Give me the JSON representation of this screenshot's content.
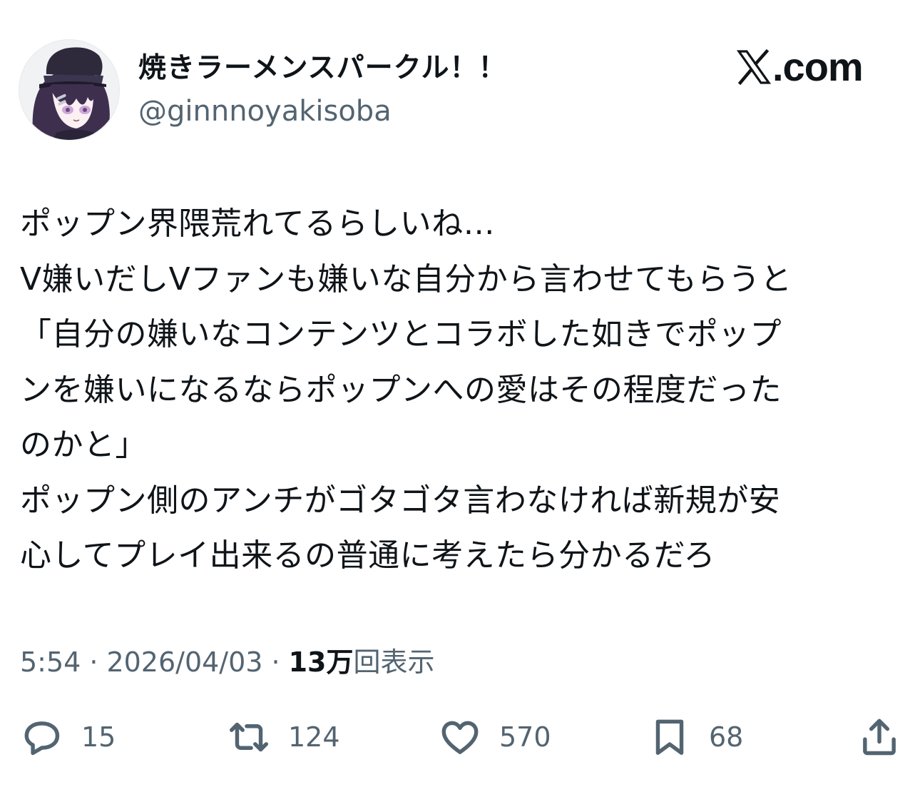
{
  "author": {
    "display_name": "焼きラーメンスパークル！！",
    "handle": "@ginnnoyakisoba"
  },
  "brand": {
    "icon": "x-logo-icon",
    "domain": ".com"
  },
  "tweet": {
    "lines": [
      "ポップン界隈荒れてるらしいね…",
      "V嫌いだしVファンも嫌いな自分から言わせてもらうと",
      "「自分の嫌いなコンテンツとコラボした如きでポップ",
      "ンを嫌いになるならポップンへの愛はその程度だった",
      "のかと」",
      "ポップン側のアンチがゴタゴタ言わなければ新規が安",
      "心してプレイ出来るの普通に考えたら分かるだろ"
    ]
  },
  "meta": {
    "time": "5:54",
    "separator": "·",
    "date": "2026/04/03",
    "views_count": "13万",
    "views_label": "回表示"
  },
  "actions": {
    "reply": {
      "icon": "reply-icon",
      "count": "15"
    },
    "repost": {
      "icon": "repost-icon",
      "count": "124"
    },
    "like": {
      "icon": "heart-icon",
      "count": "570"
    },
    "bookmark": {
      "icon": "bookmark-icon",
      "count": "68"
    },
    "share": {
      "icon": "share-icon"
    }
  },
  "colors": {
    "text_primary": "#0f1419",
    "text_secondary": "#536471",
    "background": "#ffffff"
  }
}
